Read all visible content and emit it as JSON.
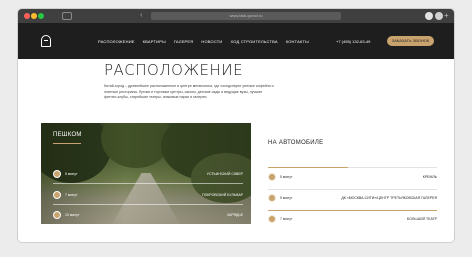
{
  "browser": {
    "address": "www.kitai-gorod.ru"
  },
  "nav": {
    "menu": [
      "РАСПОЛОЖЕНИЕ",
      "КВАРТИРЫ",
      "ГАЛЕРЕЯ",
      "НОВОСТИ",
      "ХОД СТРОИТЕЛЬСТВА",
      "КОНТАКТЫ"
    ],
    "phone": "+7 (495) 132-63-49",
    "call_button": "ЗАКАЗАТЬ ЗВОНОК"
  },
  "section": {
    "title": "РАСПОЛОЖЕНИЕ",
    "description": "Китай-город – древнейшее расположенное в центре мегаполиса, где соседствуют уютные кофейни и элитные рестораны, бутики и торговые центры, школы, детские сады и ведущие вузы, лучшие фитнес-клубы, старейшие театры, знаковые парки и галереи."
  },
  "walk": {
    "title": "ПЕШКОМ",
    "items": [
      {
        "time": "5 минут",
        "place": "УСТЬИНСКИЙ СКВЕР"
      },
      {
        "time": "7 минут",
        "place": "ПОКРОВСКИЙ БУЛЬВАР"
      },
      {
        "time": "10 минут",
        "place": "ЗАРЯДЬЕ"
      }
    ]
  },
  "car": {
    "title": "НА АВТОМОБИЛЕ",
    "items": [
      {
        "time": "5 минут",
        "place": "КРЕМЛЬ"
      },
      {
        "time": "5 минут",
        "place": "ДК «МОСКВА-СИТИ»/ЦЕНТР ТРЕТЬЯКОВСКАЯ ГАЛЕРЕЯ"
      },
      {
        "time": "7 минут",
        "place": "БОЛЬШОЙ ТЕАТР"
      }
    ]
  },
  "colors": {
    "accent": "#c9a36e",
    "nav_bg": "#1e1e1e"
  }
}
